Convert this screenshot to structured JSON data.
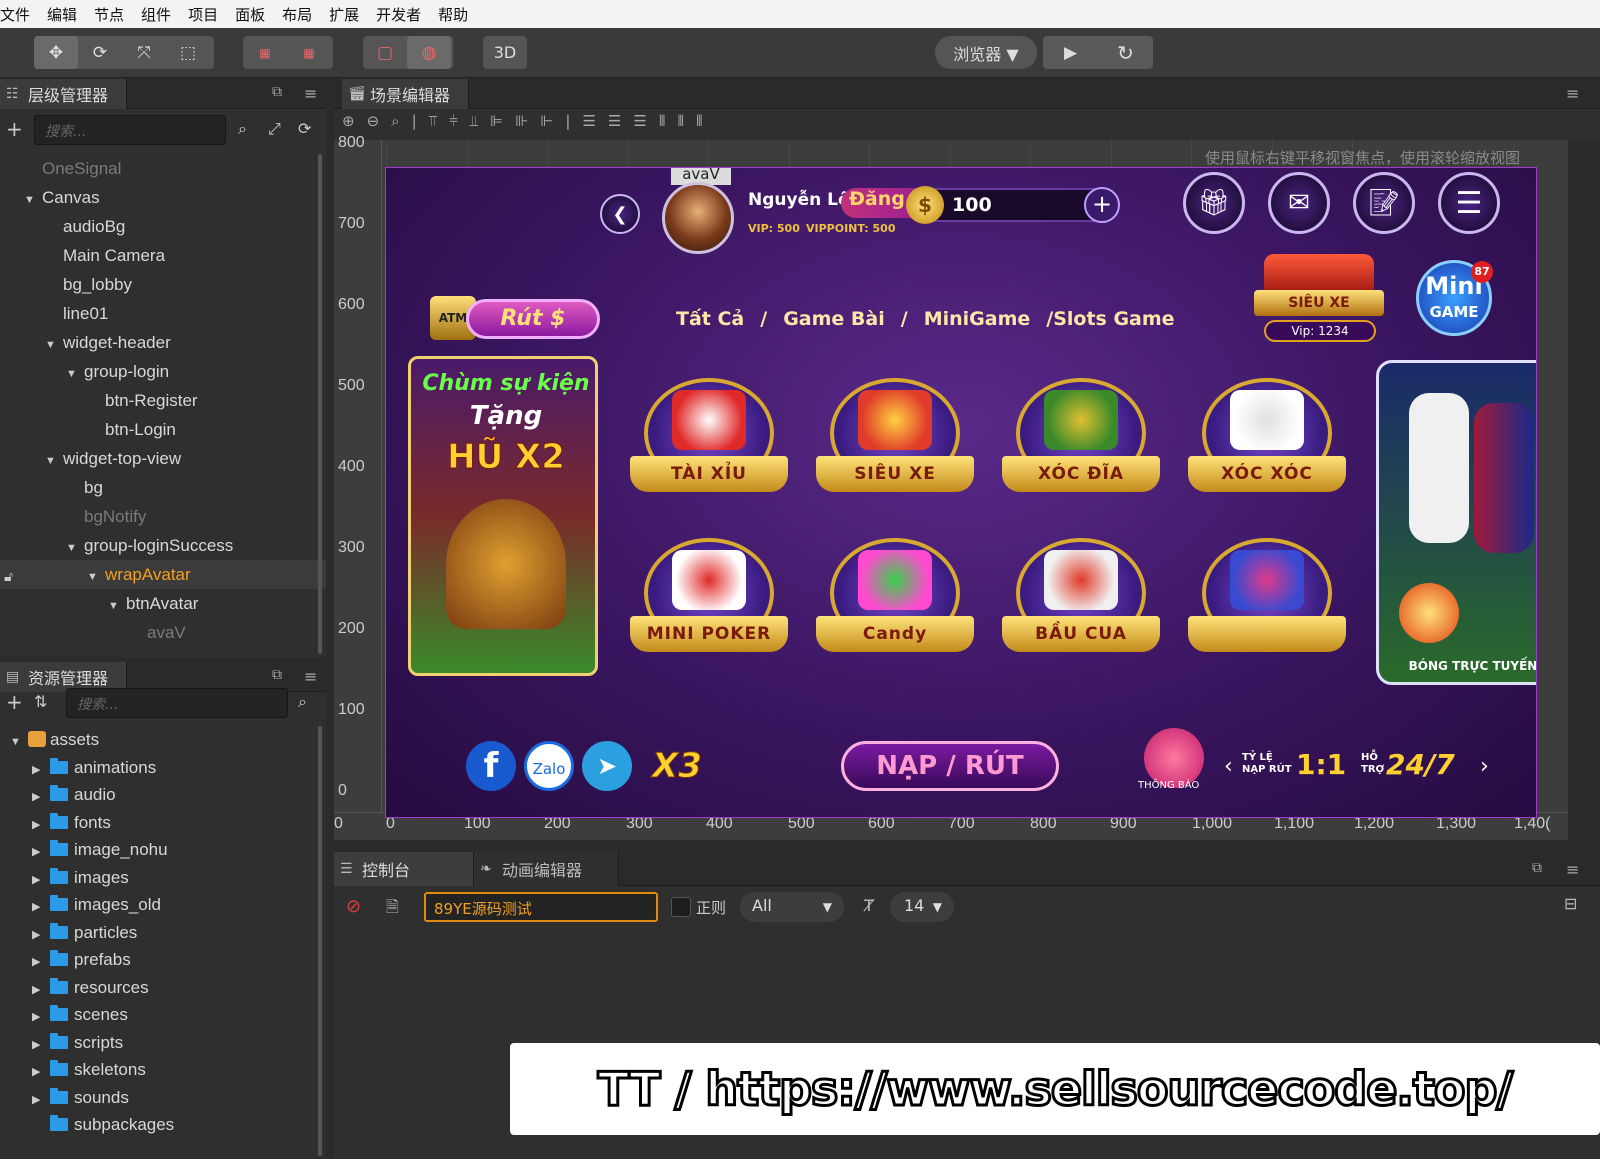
{
  "menu": [
    "文件",
    "编辑",
    "节点",
    "组件",
    "项目",
    "面板",
    "布局",
    "扩展",
    "开发者",
    "帮助"
  ],
  "toolbar": {
    "browser_label": "浏览器 ▼",
    "mode_3d": "3D",
    "play_icon": "▶",
    "refresh_icon": "↻"
  },
  "hierarchy": {
    "title": "层级管理器",
    "search_placeholder": "搜索...",
    "nodes": [
      {
        "label": "OneSignal",
        "depth": 0,
        "arrow": "",
        "dim": true
      },
      {
        "label": "Canvas",
        "depth": 0,
        "arrow": "▼",
        "dim": false
      },
      {
        "label": "audioBg",
        "depth": 1,
        "arrow": "",
        "dim": false
      },
      {
        "label": "Main Camera",
        "depth": 1,
        "arrow": "",
        "dim": false
      },
      {
        "label": "bg_lobby",
        "depth": 1,
        "arrow": "",
        "dim": false
      },
      {
        "label": "line01",
        "depth": 1,
        "arrow": "",
        "dim": false
      },
      {
        "label": "widget-header",
        "depth": 1,
        "arrow": "▼",
        "dim": false
      },
      {
        "label": "group-login",
        "depth": 2,
        "arrow": "▼",
        "dim": false
      },
      {
        "label": "btn-Register",
        "depth": 3,
        "arrow": "",
        "dim": false
      },
      {
        "label": "btn-Login",
        "depth": 3,
        "arrow": "",
        "dim": false
      },
      {
        "label": "widget-top-view",
        "depth": 1,
        "arrow": "▼",
        "dim": false
      },
      {
        "label": "bg",
        "depth": 2,
        "arrow": "",
        "dim": false
      },
      {
        "label": "bgNotify",
        "depth": 2,
        "arrow": "",
        "dim": true
      },
      {
        "label": "group-loginSuccess",
        "depth": 2,
        "arrow": "▼",
        "dim": false
      },
      {
        "label": "wrapAvatar",
        "depth": 3,
        "arrow": "▼",
        "dim": false,
        "selected": true
      },
      {
        "label": "btnAvatar",
        "depth": 4,
        "arrow": "▼",
        "dim": false
      },
      {
        "label": "avaV",
        "depth": 5,
        "arrow": "",
        "dim": true
      }
    ]
  },
  "assets": {
    "title": "资源管理器",
    "search_placeholder": "搜索...",
    "root": "assets",
    "folders": [
      "animations",
      "audio",
      "fonts",
      "image_nohu",
      "images",
      "images_old",
      "particles",
      "prefabs",
      "resources",
      "scenes",
      "scripts",
      "skeletons",
      "sounds",
      "subpackages"
    ]
  },
  "scene": {
    "title": "场景编辑器",
    "hint": "使用鼠标右键平移视窗焦点，使用滚轮缩放视图",
    "ruler_y": [
      "800",
      "700",
      "600",
      "500",
      "400",
      "300",
      "200",
      "100",
      "0"
    ],
    "ruler_x": [
      "0",
      "0",
      "100",
      "200",
      "300",
      "400",
      "500",
      "600",
      "700",
      "800",
      "900",
      "1,000",
      "1,100",
      "1,200",
      "1,300",
      "1,40("
    ]
  },
  "game": {
    "avatar_label": "avaV",
    "player_name": "Nguyễn Lê",
    "login_text": "Đăng",
    "vip": "VIP: 500",
    "vippoint": "VIPPOINT: 500",
    "coins": "100",
    "coin_symbol": "$",
    "withdraw_btn": "Rút $",
    "atm_label": "ATM",
    "categories": [
      "Tất Cả",
      "/",
      "Game Bài",
      "/",
      "MiniGame",
      "/Slots Game"
    ],
    "sieu_xe_promo": "SIÊU XE",
    "vip_promo": "Vip: 1234",
    "mini_game": [
      "Mini",
      "GAME"
    ],
    "mini_badge": "87",
    "event_banner": [
      "Chùm sự kiện",
      "Tặng",
      "HŨ X2"
    ],
    "games_row1": [
      "TÀI XỈU",
      "SIÊU XE",
      "XÓC ĐĨA",
      "XÓC XÓC"
    ],
    "games_row2": [
      "MINI POKER",
      "Candy",
      "BẦU CUA",
      ""
    ],
    "football_banner": "BÓNG TRỰC TUYẾN",
    "x3": "X3",
    "nap_rut": "NẠP / RÚT",
    "notify_label": "THÔNG BÁO",
    "rate_label": [
      "TỶ LỆ",
      "NẠP RÚT"
    ],
    "rate_value": "1:1",
    "support_label": [
      "HỖ",
      "TRỢ"
    ],
    "support_value": "24/7",
    "zalo": "Zalo",
    "facebook": "f"
  },
  "console": {
    "tab_console": "控制台",
    "tab_anim": "动画编辑器",
    "filter_value": "89YE源码测试",
    "regex_label": "正则",
    "level": "All",
    "font_size": "14"
  },
  "watermark": "TT / https://www.sellsourcecode.top/",
  "colors": {
    "accent": "#f0a020",
    "folder": "#2b9be8",
    "game_bg": "#3a1560"
  }
}
